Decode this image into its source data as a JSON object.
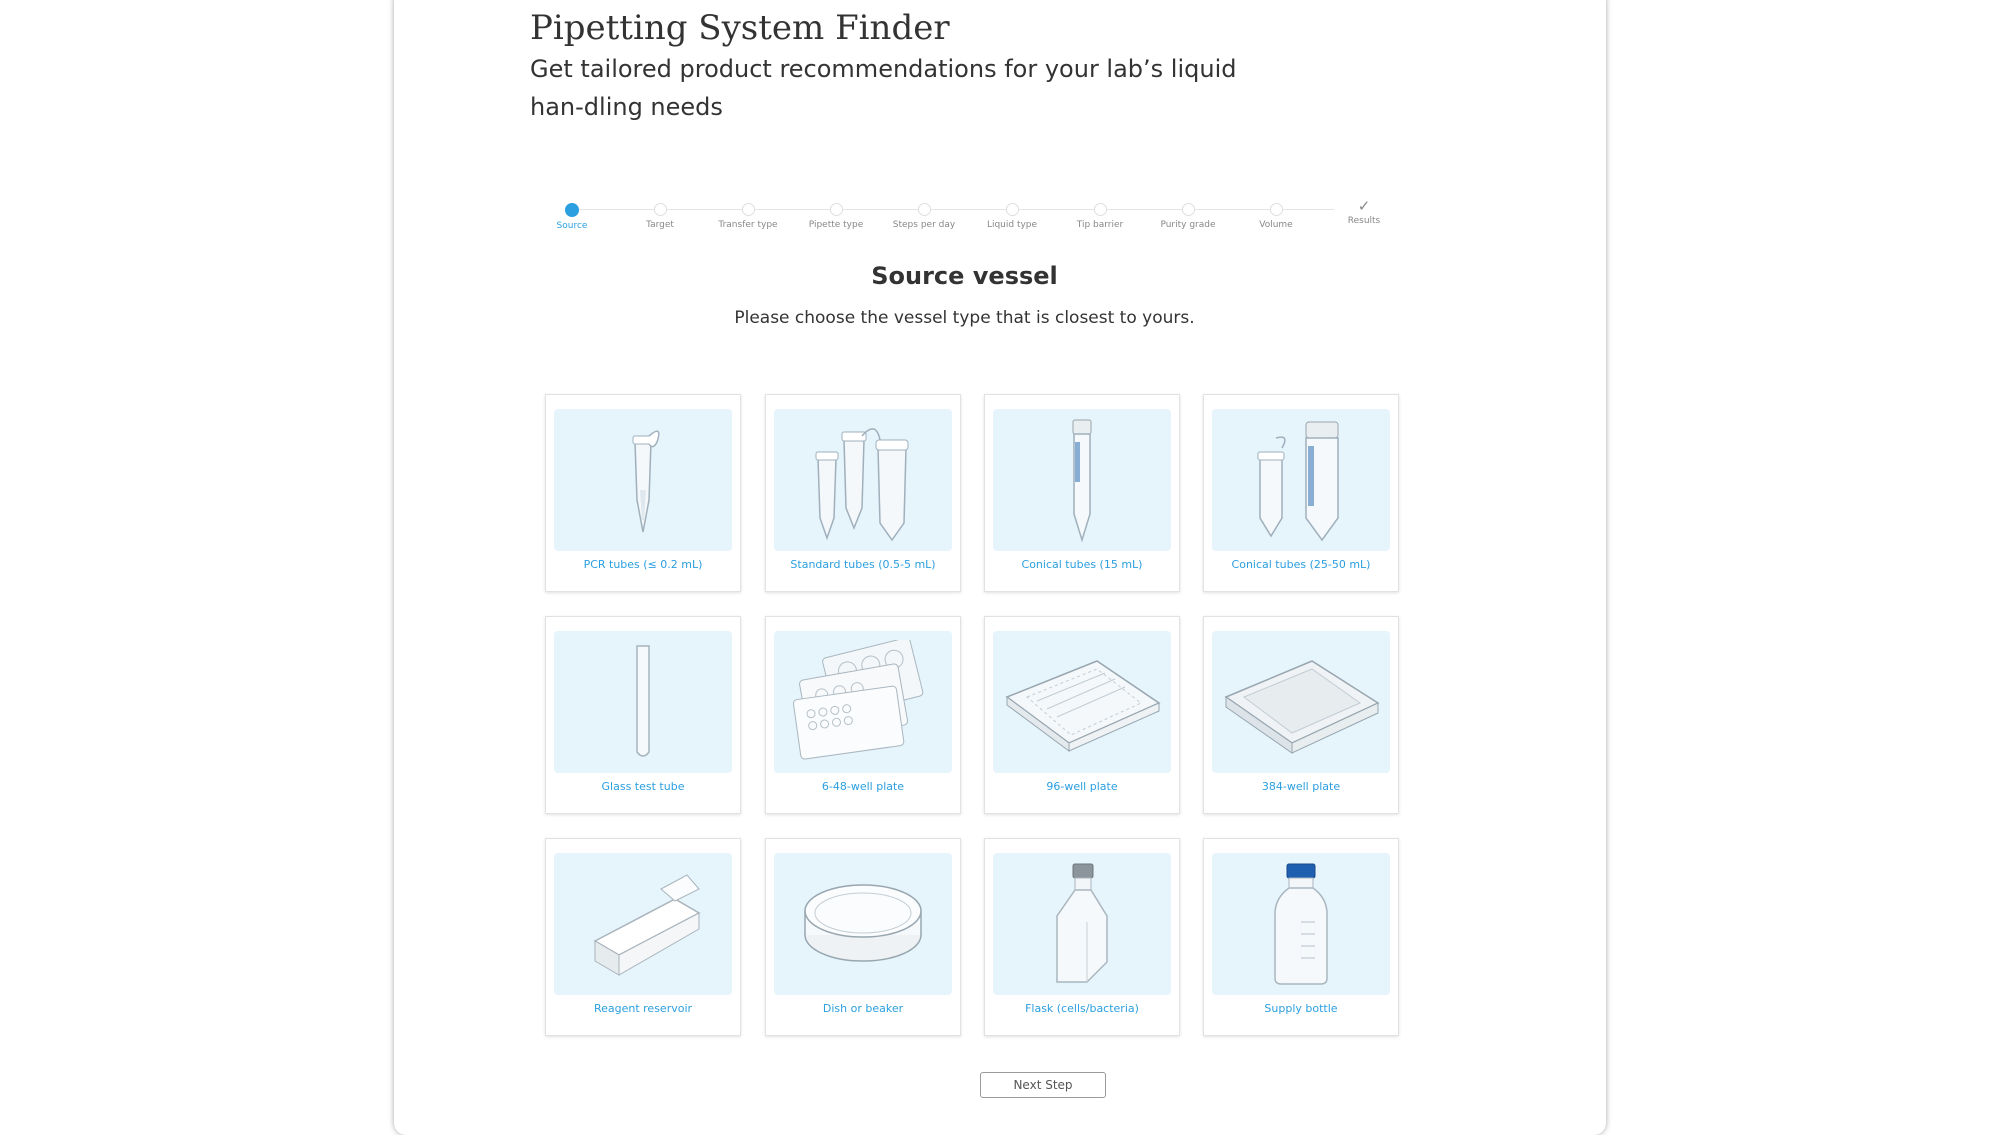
{
  "header": {
    "title": "Pipetting System Finder",
    "subtitle": "Get tailored product recommendations for your lab’s liquid han-dling needs"
  },
  "stepper": {
    "steps": [
      "Source",
      "Target",
      "Transfer type",
      "Pipette type",
      "Steps per day",
      "Liquid type",
      "Tip barrier",
      "Purity grade",
      "Volume",
      "Results"
    ],
    "active": "Source",
    "active_color": "#2b9fe0"
  },
  "section": {
    "title": "Source vessel",
    "description": "Please choose the vessel type that is closest to yours."
  },
  "vessels": [
    {
      "label": "PCR tubes (≤ 0.2 mL)",
      "icon": "pcr-tube-icon"
    },
    {
      "label": "Standard tubes (0.5-5 mL)",
      "icon": "standard-tubes-icon"
    },
    {
      "label": "Conical tubes (15 mL)",
      "icon": "conical-tube-15-icon"
    },
    {
      "label": "Conical tubes (25-50 mL)",
      "icon": "conical-tubes-50-icon"
    },
    {
      "label": "Glass test tube",
      "icon": "glass-test-tube-icon"
    },
    {
      "label": "6-48-well plate",
      "icon": "well-plates-6-48-icon"
    },
    {
      "label": "96-well plate",
      "icon": "well-plate-96-icon"
    },
    {
      "label": "384-well plate",
      "icon": "well-plate-384-icon"
    },
    {
      "label": "Reagent reservoir",
      "icon": "reagent-reservoir-icon"
    },
    {
      "label": "Dish or beaker",
      "icon": "dish-icon"
    },
    {
      "label": "Flask (cells/bacteria)",
      "icon": "flask-icon"
    },
    {
      "label": "Supply bottle",
      "icon": "supply-bottle-icon"
    }
  ],
  "footer": {
    "next_label": "Next Step"
  },
  "colors": {
    "accent": "#2b9fe0",
    "card_image_bg": "#e6f4fc"
  }
}
